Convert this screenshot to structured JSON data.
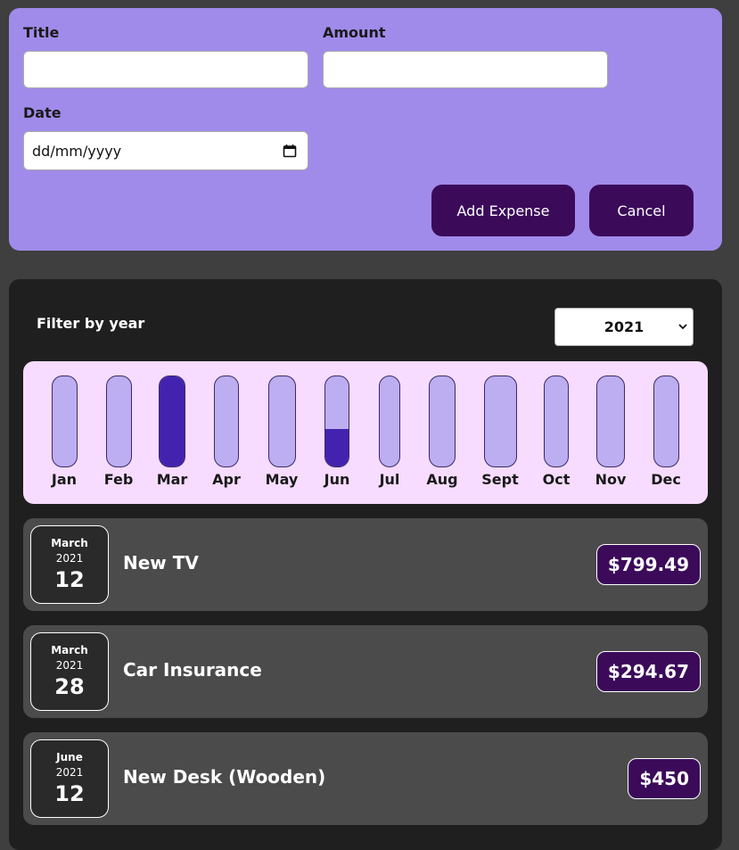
{
  "form": {
    "title_label": "Title",
    "title_value": "",
    "amount_label": "Amount",
    "amount_value": "",
    "date_label": "Date",
    "date_placeholder": "dd/mm/yyyy",
    "add_button": "Add Expense",
    "cancel_button": "Cancel"
  },
  "filter": {
    "label": "Filter by year",
    "selected_year": "2021"
  },
  "colors": {
    "form_bg": "#a08bea",
    "button_bg": "#3b0b5a",
    "chart_bg": "#f7dcff",
    "bar_track": "#bcaef0",
    "bar_fill": "#4322b0"
  },
  "chart_data": {
    "type": "bar",
    "categories": [
      "Jan",
      "Feb",
      "Mar",
      "Apr",
      "May",
      "Jun",
      "Jul",
      "Aug",
      "Sept",
      "Oct",
      "Nov",
      "Dec"
    ],
    "values": [
      0,
      0,
      1094.16,
      0,
      0,
      450,
      0,
      0,
      0,
      0,
      0,
      0
    ],
    "fill_fraction": [
      0,
      0,
      1.0,
      0,
      0,
      0.41,
      0,
      0,
      0,
      0,
      0,
      0
    ]
  },
  "expenses": [
    {
      "month": "March",
      "year": "2021",
      "day": "12",
      "title": "New TV",
      "amount": "$799.49"
    },
    {
      "month": "March",
      "year": "2021",
      "day": "28",
      "title": "Car Insurance",
      "amount": "$294.67"
    },
    {
      "month": "June",
      "year": "2021",
      "day": "12",
      "title": "New Desk (Wooden)",
      "amount": "$450"
    }
  ]
}
